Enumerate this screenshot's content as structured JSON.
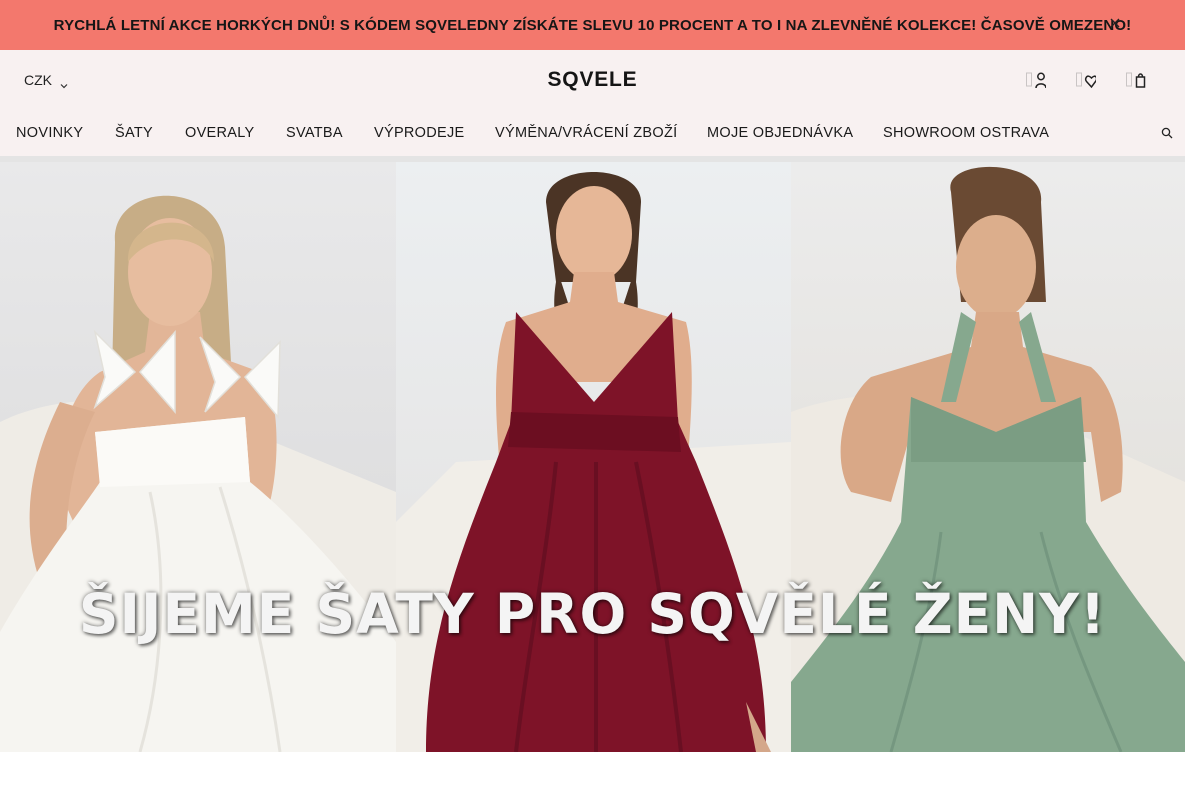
{
  "promo": {
    "text": "RYCHLÁ LETNÍ AKCE HORKÝCH DNŮ! S KÓDEM SQVELEDNY ZÍSKÁTE SLEVU 10 PROCENT A TO I NA ZLEVNĚNÉ KOLEKCE! ČASOVĚ OMEZENO!",
    "close_icon": "close-icon",
    "background": "#f3786d"
  },
  "header": {
    "currency": "CZK",
    "brand": "SQVELE",
    "icons": [
      "user-icon",
      "heart-icon",
      "cart-icon"
    ],
    "background": "#f8f1f1"
  },
  "nav": {
    "items": [
      {
        "label": "NOVINKY"
      },
      {
        "label": "ŠATY"
      },
      {
        "label": "OVERALY"
      },
      {
        "label": "SVATBA"
      },
      {
        "label": "VÝPRODEJE"
      },
      {
        "label": "VÝMĚNA/VRÁCENÍ ZBOŽÍ"
      },
      {
        "label": "MOJE OBJEDNÁVKA"
      },
      {
        "label": "SHOWROOM OSTRAVA"
      }
    ],
    "search_icon": "search-icon"
  },
  "hero": {
    "caption": "ŠIJEME ŠATY PRO SQVĚLÉ ŽENY!",
    "panels": [
      {
        "dress_color": "#f6f5f1"
      },
      {
        "dress_color": "#7e1328"
      },
      {
        "dress_color": "#86a88e"
      }
    ]
  }
}
